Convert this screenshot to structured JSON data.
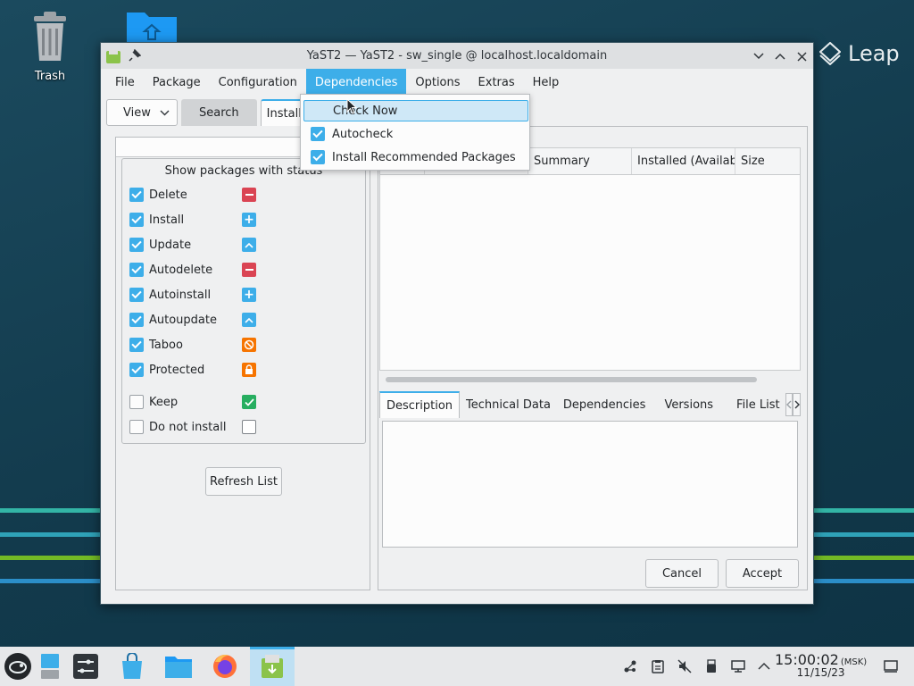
{
  "desktop": {
    "trash_label": "Trash",
    "brand": "Leap"
  },
  "window": {
    "title": "YaST2 — YaST2 - sw_single @ localhost.localdomain"
  },
  "menubar": [
    "File",
    "Package",
    "Configuration",
    "Dependencies",
    "Options",
    "Extras",
    "Help"
  ],
  "toolbar": {
    "view_label": "View",
    "search_tab": "Search",
    "installation_tab": "Installa"
  },
  "dependencies_menu": {
    "items": [
      {
        "label": "Check Now",
        "checked": false
      },
      {
        "label": "Autocheck",
        "checked": true
      },
      {
        "label": "Install Recommended Packages",
        "checked": true
      }
    ]
  },
  "status_filter": {
    "title": "Show packages with status",
    "rows": [
      {
        "label": "Delete",
        "checked": true,
        "icon": "minus-icon",
        "color": "#da4453"
      },
      {
        "label": "Install",
        "checked": true,
        "icon": "plus-icon",
        "color": "#3daee9"
      },
      {
        "label": "Update",
        "checked": true,
        "icon": "arrow-up-icon",
        "color": "#3daee9"
      },
      {
        "label": "Autodelete",
        "checked": true,
        "icon": "minus-icon",
        "color": "#da4453"
      },
      {
        "label": "Autoinstall",
        "checked": true,
        "icon": "plus-icon",
        "color": "#3daee9"
      },
      {
        "label": "Autoupdate",
        "checked": true,
        "icon": "arrow-up-icon",
        "color": "#3daee9"
      },
      {
        "label": "Taboo",
        "checked": true,
        "icon": "no-entry-icon",
        "color": "#f67400"
      },
      {
        "label": "Protected",
        "checked": true,
        "icon": "lock-icon",
        "color": "#f67400"
      },
      {
        "label": "Keep",
        "checked": false,
        "icon": "check-icon",
        "color": "#27ae60"
      },
      {
        "label": "Do not install",
        "checked": false,
        "icon": "empty-box-icon",
        "color": "#ffffff"
      }
    ],
    "refresh_label": "Refresh List"
  },
  "package_table": {
    "columns": [
      "",
      "",
      "Summary",
      "Installed (Availab",
      "Size"
    ]
  },
  "detail_tabs": [
    "Description",
    "Technical Data",
    "Dependencies",
    "Versions",
    "File List"
  ],
  "buttons": {
    "cancel": "Cancel",
    "accept": "Accept"
  },
  "taskbar": {
    "time": "15:00:02",
    "timezone": "(MSK)",
    "date": "11/15/23"
  }
}
